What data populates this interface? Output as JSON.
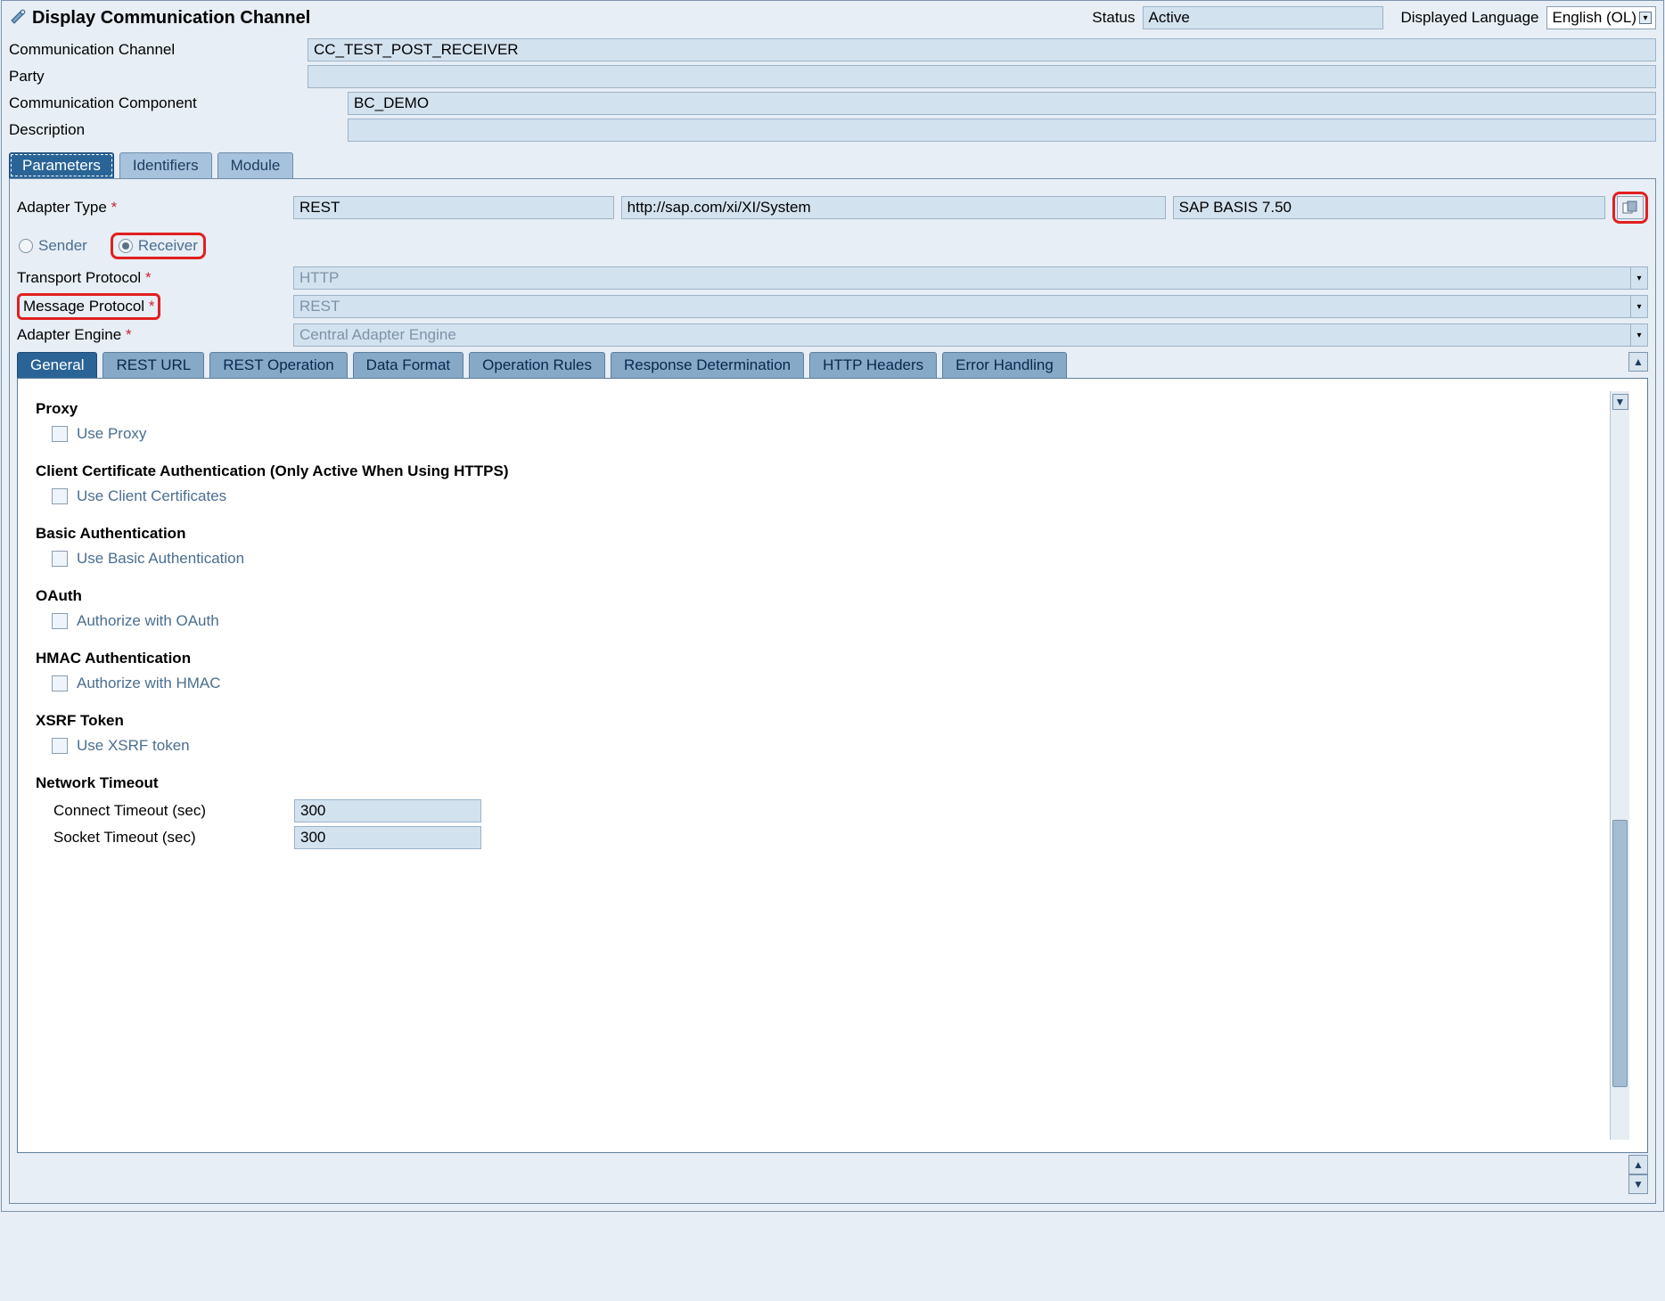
{
  "header": {
    "title": "Display Communication Channel",
    "status_label": "Status",
    "status_value": "Active",
    "lang_label": "Displayed Language",
    "lang_value": "English (OL)"
  },
  "form": {
    "channel_label": "Communication Channel",
    "channel_value": "CC_TEST_POST_RECEIVER",
    "party_label": "Party",
    "party_value": "",
    "component_label": "Communication Component",
    "component_value": "BC_DEMO",
    "description_label": "Description",
    "description_value": ""
  },
  "tabs": {
    "items": [
      "Parameters",
      "Identifiers",
      "Module"
    ],
    "active": 0
  },
  "adapter": {
    "label": "Adapter Type",
    "type": "REST",
    "namespace": "http://sap.com/xi/XI/System",
    "basis": "SAP BASIS 7.50",
    "sender_label": "Sender",
    "receiver_label": "Receiver",
    "transport_label": "Transport Protocol",
    "transport_value": "HTTP",
    "message_label": "Message Protocol",
    "message_value": "REST",
    "engine_label": "Adapter Engine",
    "engine_value": "Central Adapter Engine"
  },
  "subtabs": {
    "items": [
      "General",
      "REST URL",
      "REST Operation",
      "Data Format",
      "Operation Rules",
      "Response Determination",
      "HTTP Headers",
      "Error Handling"
    ],
    "active": 0
  },
  "general": {
    "proxy_title": "Proxy",
    "proxy_chk": "Use Proxy",
    "cca_title": "Client Certificate Authentication (Only Active When Using HTTPS)",
    "cca_chk": "Use Client Certificates",
    "basic_title": "Basic Authentication",
    "basic_chk": "Use Basic Authentication",
    "oauth_title": "OAuth",
    "oauth_chk": "Authorize with OAuth",
    "hmac_title": "HMAC Authentication",
    "hmac_chk": "Authorize with HMAC",
    "xsrf_title": "XSRF Token",
    "xsrf_chk": "Use XSRF token",
    "timeout_title": "Network Timeout",
    "connect_label": "Connect Timeout (sec)",
    "connect_value": "300",
    "socket_label": "Socket Timeout (sec)",
    "socket_value": "300"
  }
}
